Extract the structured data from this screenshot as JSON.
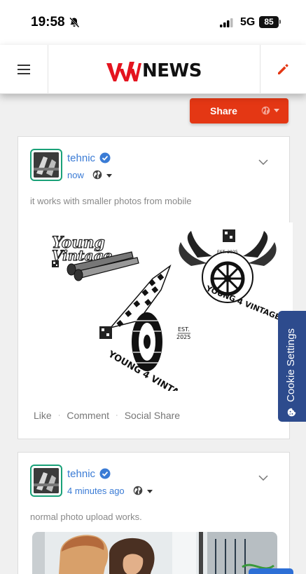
{
  "status_bar": {
    "time": "19:58",
    "network": "5G",
    "battery": "85"
  },
  "header": {
    "logo_news": "NEWS",
    "accent": "#e43714",
    "logo_red": "#e4141f"
  },
  "share": {
    "label": "Share"
  },
  "posts": [
    {
      "author": "tehnic",
      "time": "now",
      "text": "it works with smaller photos from mobile",
      "actions": {
        "like": "Like",
        "comment": "Comment",
        "social_share": "Social Share"
      },
      "image": {
        "logo_text": "Young Vintage",
        "tagline": "YOUNG 4 VINTAGE",
        "est": "EST. 2025",
        "est_line1": "EST.",
        "est_line2": "2025"
      }
    },
    {
      "author": "tehnic",
      "time": "4 minutes ago",
      "text": "normal photo upload works."
    }
  ],
  "cookie": {
    "label": "Cookie Settings"
  }
}
